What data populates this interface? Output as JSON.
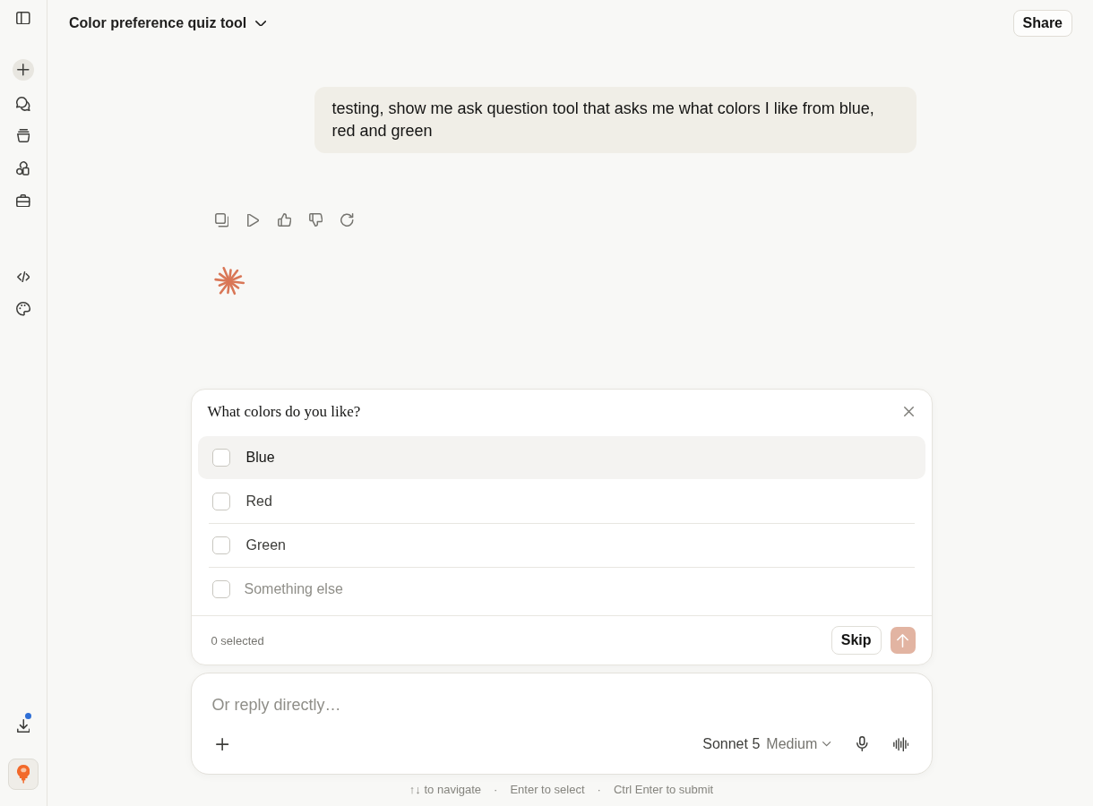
{
  "sidebar": {
    "download_notification": true
  },
  "header": {
    "title": "Color preference quiz tool",
    "share": "Share"
  },
  "messages": [
    {
      "text": "testing, show me ask question tool that asks me what colors I like from blue, red and green"
    }
  ],
  "question": {
    "title": "What colors do you like?",
    "options": [
      {
        "kind": "choice",
        "label": "Blue",
        "checked": false,
        "focused": true
      },
      {
        "kind": "choice",
        "label": "Red",
        "checked": false,
        "focused": false
      },
      {
        "kind": "choice",
        "label": "Green",
        "checked": false,
        "focused": false
      },
      {
        "kind": "other",
        "placeholder": "Something else",
        "checked": false,
        "focused": false
      }
    ],
    "selected_count": "0 selected",
    "skip": "Skip",
    "submit_disabled": true
  },
  "composer": {
    "placeholder": "Or reply directly…",
    "model": "Sonnet 5",
    "effort": "Medium"
  },
  "hints": {
    "items": [
      "↑↓ to navigate",
      "Enter to select",
      "Ctrl Enter to submit"
    ],
    "separator": "·"
  }
}
